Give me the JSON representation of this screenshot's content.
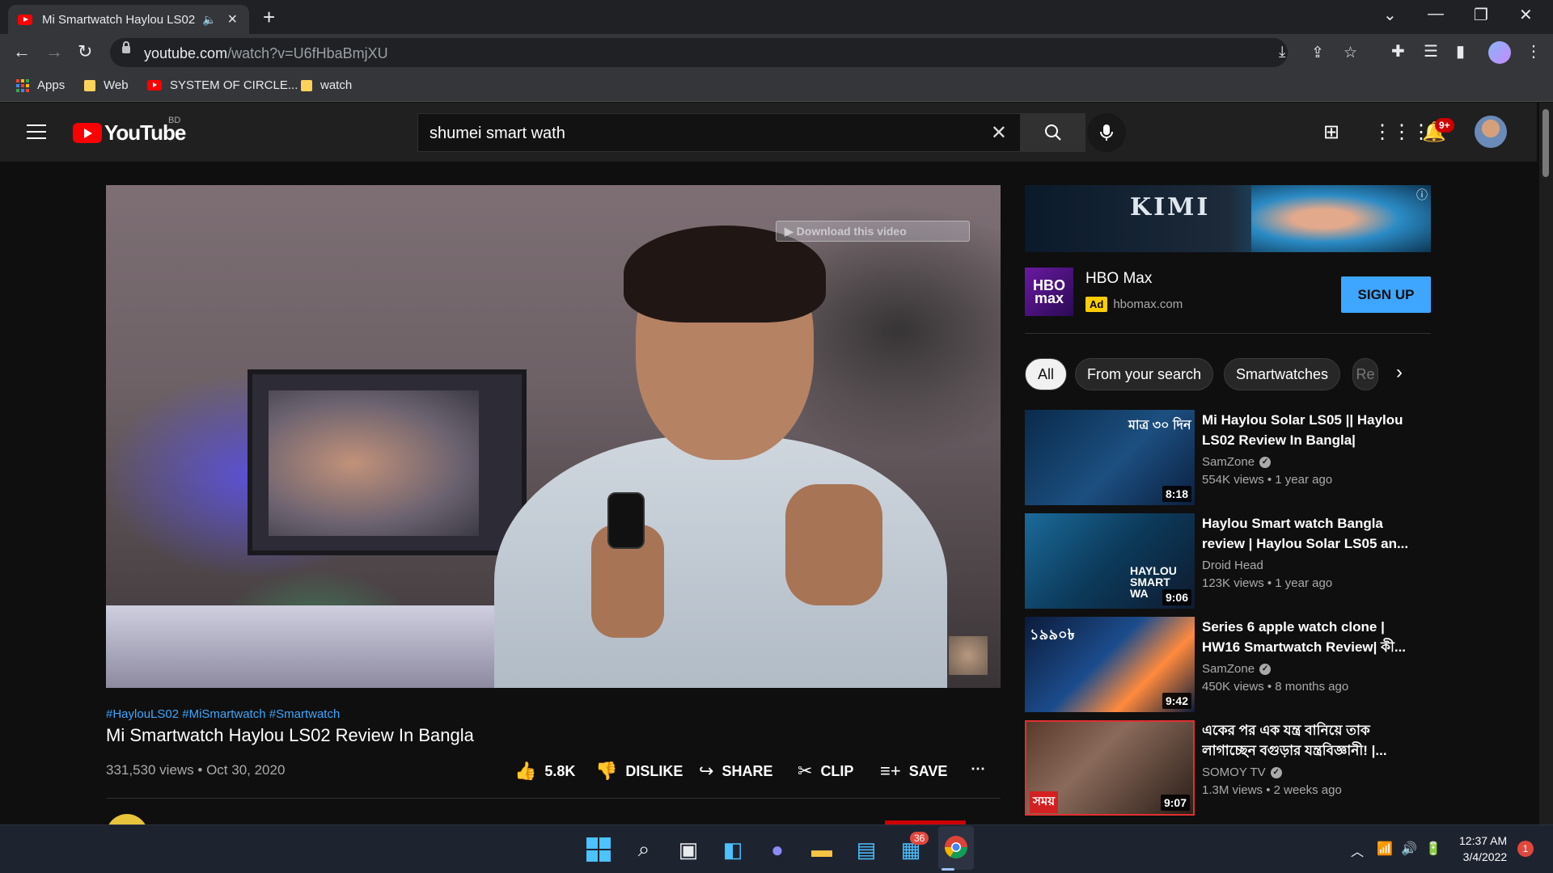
{
  "browser": {
    "tab_title": "Mi Smartwatch Haylou LS02",
    "tab_audio_icon": "speaker-icon",
    "url_host": "youtube.com",
    "url_path": "/watch?v=U6fHbaBmjXU",
    "bookmarks": [
      "Apps",
      "Web",
      "SYSTEM OF CIRCLE...",
      "watch"
    ]
  },
  "masthead": {
    "logo_word": "YouTube",
    "country_code": "BD",
    "search_value": "shumei smart wath",
    "notification_count": "9+"
  },
  "video": {
    "overlay_download": "▶ Download this video",
    "hashtags": "#HaylouLS02 #MiSmartwatch #Smartwatch",
    "title": "Mi Smartwatch Haylou LS02 Review In Bangla",
    "views_date": "331,530 views • Oct 30, 2020",
    "actions": {
      "likes": "5.8K",
      "dislike": "DISLIKE",
      "share": "SHARE",
      "clip": "CLIP",
      "save": "SAVE"
    }
  },
  "ad": {
    "banner_text": "KIMI",
    "advertiser": "HBO Max",
    "logo_text": "HBO max",
    "badge": "Ad",
    "site": "hbomax.com",
    "cta": "SIGN UP"
  },
  "chips": [
    "All",
    "From your search",
    "Smartwatches",
    "Re"
  ],
  "recommendations": [
    {
      "title": "Mi Haylou Solar LS05 || Haylou LS02 Review In Bangla|",
      "channel": "SamZone",
      "verified": true,
      "meta": "554K views • 1 year ago",
      "duration": "8:18",
      "thumb_text": "মাত্র ৩০ দিন"
    },
    {
      "title": "Haylou Smart watch Bangla review | Haylou Solar LS05 an...",
      "channel": "Droid Head",
      "verified": false,
      "meta": "123K views • 1 year ago",
      "duration": "9:06",
      "thumb_text": "HAYLOU SMART WA"
    },
    {
      "title": "Series 6 apple watch clone | HW16 Smartwatch Review| কী...",
      "channel": "SamZone",
      "verified": true,
      "meta": "450K views • 8 months ago",
      "duration": "9:42",
      "thumb_text": "১৯৯০৳"
    },
    {
      "title": "একের পর এক যন্ত্র বানিয়ে তাক লাগাচ্ছেন বগুড়ার যন্ত্রবিজ্ঞানী! |...",
      "channel": "SOMOY TV",
      "verified": true,
      "meta": "1.3M views • 2 weeks ago",
      "duration": "9:07",
      "thumb_text": "সময়"
    }
  ],
  "taskbar": {
    "store_badge": "36",
    "time": "12:37 AM",
    "date": "3/4/2022",
    "notification_count": "1"
  }
}
